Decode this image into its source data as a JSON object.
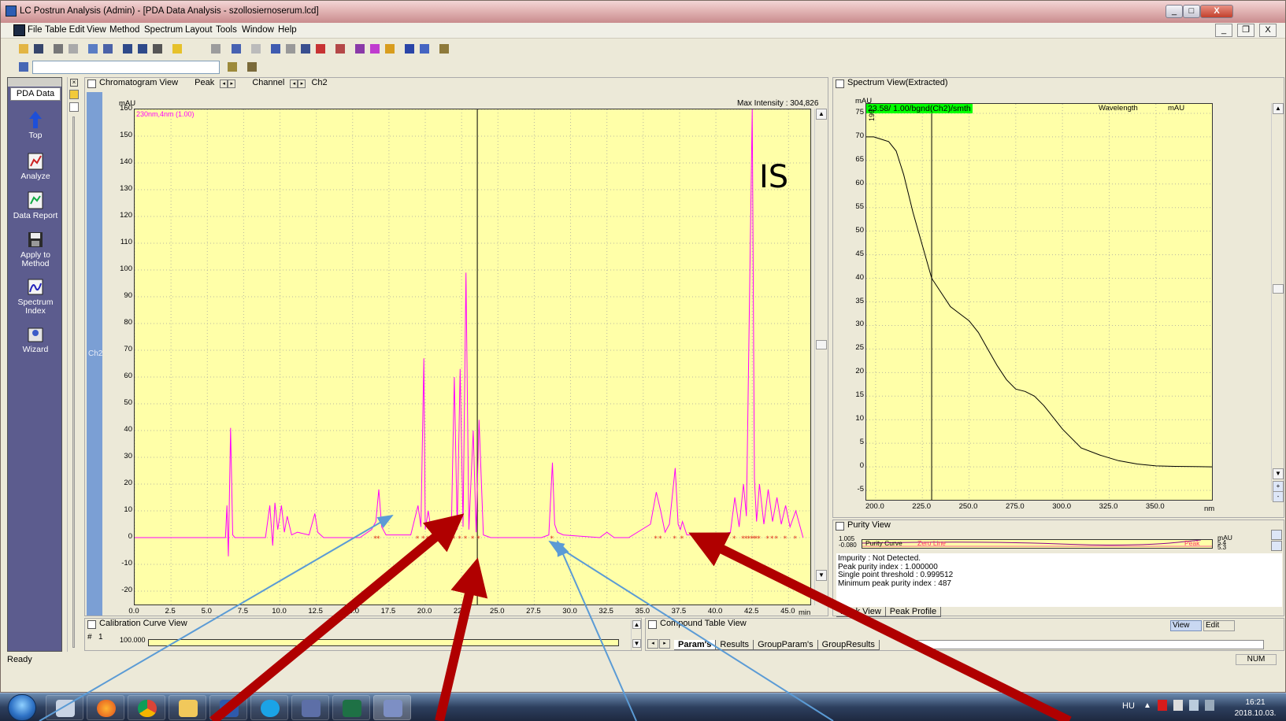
{
  "window": {
    "title": "LC Postrun Analysis (Admin) - [PDA Data Analysis - szollosiernoserum.lcd]",
    "minimize": "_",
    "maximize": "□",
    "close": "X",
    "mdi_minimize": "_",
    "mdi_restore": "❐",
    "mdi_close": "X"
  },
  "menu": [
    "File",
    "Table Edit",
    "View",
    "Method",
    "Spectrum",
    "Layout",
    "Tools",
    "Window",
    "Help"
  ],
  "sidebar": {
    "tab": "PDA Data",
    "items": [
      "Top",
      "Analyze",
      "Data Report",
      "Apply to Method",
      "Spectrum Index",
      "Wizard"
    ]
  },
  "chromatogram": {
    "pane_title": "Chromatogram View",
    "peak_label": "Peak",
    "channel_label": "Channel",
    "channel_value": "Ch2",
    "side_label": "Ch2",
    "max_intensity": "Max Intensity : 304,826",
    "y_unit": "mAU",
    "x_unit": "min",
    "trace_label": "230nm,4nm (1.00)",
    "annotation": "IS"
  },
  "spectrum": {
    "pane_title": "Spectrum View(Extracted)",
    "y_unit": "mAU",
    "x_unit": "nm",
    "tag": "23.58/ 1.00/bgnd(Ch2)/smth",
    "wavelength_label": "Wavelength",
    "mau_label": "mAU",
    "peak_marker": "199"
  },
  "purity": {
    "pane_title": "Purity View",
    "curve_label": "Purity Curve",
    "zero_label": "Zero Line",
    "peak_label": "Peak",
    "y_top": "1.005",
    "y_bottom": "-0.080",
    "unit": "mAU",
    "right_val1": "5.4",
    "right_val2": "5.3",
    "lines": [
      "Impurity : Not Detected.",
      "Peak purity index : 1.000000",
      "Single point threshold : 0.999512",
      "Minimum peak purity index : 487"
    ],
    "tabs": [
      "Peak View",
      "Peak Profile"
    ]
  },
  "calibration": {
    "pane_title": "Calibration Curve View",
    "hash": "#",
    "num": "1",
    "val": "100.000"
  },
  "compound": {
    "pane_title": "Compound Table View",
    "view_btn": "View",
    "edit_btn": "Edit",
    "tabs": [
      "Param's",
      "Results",
      "GroupParam's",
      "GroupResults"
    ]
  },
  "status": {
    "left": "Ready",
    "num": "NUM"
  },
  "taskbar": {
    "lang": "HU",
    "time": "16:21",
    "date": "2018.10.03."
  },
  "chart_data": {
    "type": "line",
    "title": "",
    "xlabel": "min",
    "ylabel": "mAU",
    "xlim": [
      0,
      46.5
    ],
    "ylim": [
      -25,
      160
    ],
    "xticks": [
      0.0,
      2.5,
      5.0,
      7.5,
      10.0,
      12.5,
      15.0,
      17.5,
      20.0,
      22.5,
      25.0,
      27.5,
      30.0,
      32.5,
      35.0,
      37.5,
      40.0,
      42.5,
      45.0
    ],
    "yticks": [
      160,
      150,
      140,
      130,
      120,
      110,
      100,
      90,
      80,
      70,
      60,
      50,
      40,
      30,
      20,
      10,
      0,
      -10,
      -20
    ],
    "cursor_x": 23.58,
    "series": [
      {
        "name": "230nm,4nm (1.00)",
        "color": "#ff00ff",
        "x": [
          0,
          6.0,
          6.25,
          6.35,
          6.45,
          6.6,
          6.75,
          6.9,
          7.1,
          9.0,
          9.3,
          9.5,
          9.65,
          9.85,
          10.1,
          10.3,
          10.5,
          10.8,
          11.2,
          12.0,
          12.4,
          12.6,
          12.8,
          13.0,
          15.5,
          16.3,
          16.6,
          16.8,
          17.0,
          17.3,
          19.0,
          19.5,
          19.7,
          19.9,
          20.0,
          20.2,
          20.4,
          20.7,
          21.0,
          21.8,
          22.0,
          22.2,
          22.4,
          22.6,
          22.8,
          23.0,
          23.3,
          23.5,
          23.7,
          24.0,
          24.5,
          27.0,
          28.0,
          28.5,
          28.75,
          28.9,
          29.1,
          29.5,
          32.0,
          32.5,
          33.0,
          34.0,
          35.5,
          35.9,
          36.2,
          36.5,
          36.8,
          37.2,
          37.4,
          37.55,
          37.7,
          38.0,
          40.0,
          41.0,
          41.3,
          41.6,
          41.9,
          42.1,
          42.3,
          42.5,
          42.65,
          42.8,
          43.0,
          43.3,
          43.6,
          43.9,
          44.2,
          44.5,
          44.8,
          45.1,
          45.5,
          46.0
        ],
        "y": [
          0,
          0,
          0,
          12,
          -7,
          41,
          1,
          0,
          0,
          0,
          12,
          -3,
          13,
          3,
          12,
          2,
          8,
          1,
          2,
          1,
          9,
          2,
          1,
          0,
          0,
          3,
          6,
          18,
          4,
          1,
          1,
          12,
          4,
          67,
          3,
          10,
          3,
          6,
          2,
          4,
          60,
          3,
          63,
          4,
          99,
          3,
          40,
          2,
          44,
          1,
          0,
          0,
          0,
          1,
          28,
          5,
          2,
          1,
          0,
          2,
          0,
          0,
          5,
          17,
          10,
          2,
          5,
          26,
          5,
          3,
          6,
          1,
          1,
          2,
          15,
          4,
          20,
          8,
          84,
          160,
          22,
          6,
          20,
          5,
          18,
          6,
          15,
          5,
          12,
          4,
          10,
          0
        ]
      }
    ]
  },
  "spectrum_chart": {
    "type": "line",
    "xlabel": "nm",
    "ylabel": "mAU",
    "xlim": [
      195,
      380
    ],
    "ylim": [
      -7,
      77
    ],
    "xticks": [
      200.0,
      225.0,
      250.0,
      275.0,
      300.0,
      325.0,
      350.0
    ],
    "yticks": [
      75,
      70,
      65,
      60,
      55,
      50,
      45,
      40,
      35,
      30,
      25,
      20,
      15,
      10,
      5,
      0,
      -5
    ],
    "cursor_x": 230,
    "series": [
      {
        "name": "23.58/ 1.00/bgnd(Ch2)/smth",
        "x": [
          195,
          199,
          203,
          207,
          211,
          215,
          220,
          225,
          230,
          235,
          240,
          245,
          250,
          255,
          260,
          265,
          270,
          275,
          280,
          285,
          290,
          300,
          310,
          320,
          330,
          340,
          350,
          360,
          370,
          380
        ],
        "y": [
          70,
          70,
          69.5,
          69,
          67,
          62,
          54,
          47,
          40,
          37,
          34,
          32.5,
          31,
          28.5,
          25,
          21.5,
          18.5,
          16.5,
          16,
          15,
          13,
          8,
          4,
          2.5,
          1.3,
          0.6,
          0.2,
          0.1,
          0.05,
          0
        ]
      }
    ]
  }
}
